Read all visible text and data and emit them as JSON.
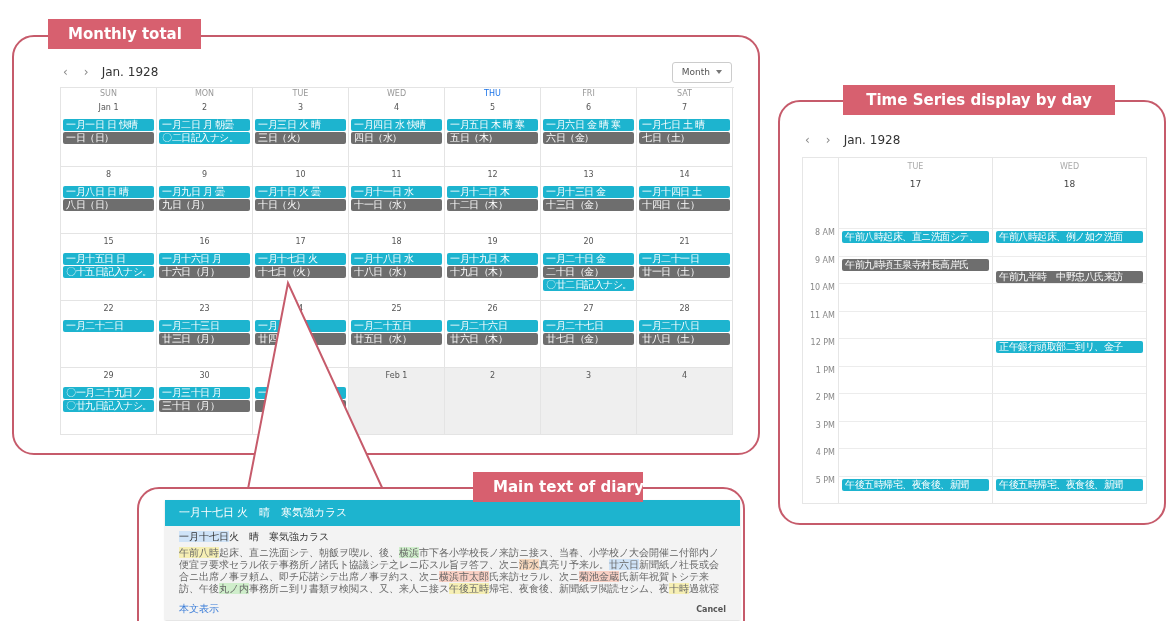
{
  "monthly": {
    "label": "Monthly total",
    "calendar": {
      "prev": "‹",
      "next": "›",
      "title": "Jan. 1928",
      "view": "Month",
      "weekdays": [
        {
          "label": "SUN",
          "today": false
        },
        {
          "label": "MON",
          "today": false
        },
        {
          "label": "TUE",
          "today": false
        },
        {
          "label": "WED",
          "today": false
        },
        {
          "label": "THU",
          "today": true
        },
        {
          "label": "FRI",
          "today": false
        },
        {
          "label": "SAT",
          "today": false
        }
      ],
      "weeks": [
        [
          {
            "date": "Jan 1",
            "outside": false,
            "events": [
              {
                "text": "一月一日 日 快晴",
                "kind": "entry"
              },
              {
                "text": "一日（日）",
                "kind": "date"
              }
            ]
          },
          {
            "date": "2",
            "outside": false,
            "events": [
              {
                "text": "一月二日 月 朝曇",
                "kind": "entry"
              },
              {
                "text": "〇二日記入ナシ。",
                "kind": "entry"
              }
            ]
          },
          {
            "date": "3",
            "outside": false,
            "events": [
              {
                "text": "一月三日 火 晴",
                "kind": "entry"
              },
              {
                "text": "三日（火）",
                "kind": "date"
              }
            ]
          },
          {
            "date": "4",
            "outside": false,
            "events": [
              {
                "text": "一月四日 水 快晴",
                "kind": "entry"
              },
              {
                "text": "四日（水）",
                "kind": "date"
              }
            ]
          },
          {
            "date": "5",
            "outside": false,
            "events": [
              {
                "text": "一月五日 木 晴 寒",
                "kind": "entry"
              },
              {
                "text": "五日（木）",
                "kind": "date"
              }
            ]
          },
          {
            "date": "6",
            "outside": false,
            "events": [
              {
                "text": "一月六日 金 晴 寒",
                "kind": "entry"
              },
              {
                "text": "六日（金）",
                "kind": "date"
              }
            ]
          },
          {
            "date": "7",
            "outside": false,
            "events": [
              {
                "text": "一月七日 土 晴",
                "kind": "entry"
              },
              {
                "text": "七日（土）",
                "kind": "date"
              }
            ]
          }
        ],
        [
          {
            "date": "8",
            "outside": false,
            "events": [
              {
                "text": "一月八日 日 晴",
                "kind": "entry"
              },
              {
                "text": "八日（日）",
                "kind": "date"
              }
            ]
          },
          {
            "date": "9",
            "outside": false,
            "events": [
              {
                "text": "一月九日 月 曇",
                "kind": "entry"
              },
              {
                "text": "九日（月）",
                "kind": "date"
              }
            ]
          },
          {
            "date": "10",
            "outside": false,
            "events": [
              {
                "text": "一月十日 火 曇",
                "kind": "entry"
              },
              {
                "text": "十日（火）",
                "kind": "date"
              }
            ]
          },
          {
            "date": "11",
            "outside": false,
            "events": [
              {
                "text": "一月十一日 水",
                "kind": "entry"
              },
              {
                "text": "十一日（水）",
                "kind": "date"
              }
            ]
          },
          {
            "date": "12",
            "outside": false,
            "events": [
              {
                "text": "一月十二日 木",
                "kind": "entry"
              },
              {
                "text": "十二日（木）",
                "kind": "date"
              }
            ]
          },
          {
            "date": "13",
            "outside": false,
            "events": [
              {
                "text": "一月十三日 金",
                "kind": "entry"
              },
              {
                "text": "十三日（金）",
                "kind": "date"
              }
            ]
          },
          {
            "date": "14",
            "outside": false,
            "events": [
              {
                "text": "一月十四日 土",
                "kind": "entry"
              },
              {
                "text": "十四日（土）",
                "kind": "date"
              }
            ]
          }
        ],
        [
          {
            "date": "15",
            "outside": false,
            "events": [
              {
                "text": "一月十五日 日",
                "kind": "entry"
              },
              {
                "text": "〇十五日記入ナシ。",
                "kind": "entry"
              }
            ]
          },
          {
            "date": "16",
            "outside": false,
            "events": [
              {
                "text": "一月十六日 月",
                "kind": "entry"
              },
              {
                "text": "十六日（月）",
                "kind": "date"
              }
            ]
          },
          {
            "date": "17",
            "outside": false,
            "events": [
              {
                "text": "一月十七日 火",
                "kind": "entry"
              },
              {
                "text": "十七日（火）",
                "kind": "date"
              }
            ]
          },
          {
            "date": "18",
            "outside": false,
            "events": [
              {
                "text": "一月十八日 水",
                "kind": "entry"
              },
              {
                "text": "十八日（水）",
                "kind": "date"
              }
            ]
          },
          {
            "date": "19",
            "outside": false,
            "events": [
              {
                "text": "一月十九日 木",
                "kind": "entry"
              },
              {
                "text": "十九日（木）",
                "kind": "date"
              }
            ]
          },
          {
            "date": "20",
            "outside": false,
            "events": [
              {
                "text": "一月二十日 金",
                "kind": "entry"
              },
              {
                "text": "二十日（金）",
                "kind": "date"
              },
              {
                "text": "〇廿二日記入ナシ。",
                "kind": "entry"
              }
            ]
          },
          {
            "date": "21",
            "outside": false,
            "events": [
              {
                "text": "一月二十一日",
                "kind": "entry"
              },
              {
                "text": "廿一日（土）",
                "kind": "date"
              }
            ]
          }
        ],
        [
          {
            "date": "22",
            "outside": false,
            "events": [
              {
                "text": "一月二十二日",
                "kind": "entry"
              }
            ]
          },
          {
            "date": "23",
            "outside": false,
            "events": [
              {
                "text": "一月二十三日",
                "kind": "entry"
              },
              {
                "text": "廿三日（月）",
                "kind": "date"
              }
            ]
          },
          {
            "date": "4",
            "outside": false,
            "events": [
              {
                "text": "一月",
                "kind": "entry"
              },
              {
                "text": "廿四",
                "kind": "date"
              }
            ]
          },
          {
            "date": "25",
            "outside": false,
            "events": [
              {
                "text": "一月二十五日",
                "kind": "entry"
              },
              {
                "text": "廿五日（水）",
                "kind": "date"
              }
            ]
          },
          {
            "date": "26",
            "outside": false,
            "events": [
              {
                "text": "一月二十六日",
                "kind": "entry"
              },
              {
                "text": "廿六日（木）",
                "kind": "date"
              }
            ]
          },
          {
            "date": "27",
            "outside": false,
            "events": [
              {
                "text": "一月二十七日",
                "kind": "entry"
              },
              {
                "text": "廿七日（金）",
                "kind": "date"
              }
            ]
          },
          {
            "date": "28",
            "outside": false,
            "events": [
              {
                "text": "一月二十八日",
                "kind": "entry"
              },
              {
                "text": "廿八日（土）",
                "kind": "date"
              }
            ]
          }
        ],
        [
          {
            "date": "29",
            "outside": false,
            "events": [
              {
                "text": "〇一月二十九日ノ",
                "kind": "entry"
              },
              {
                "text": "〇廿九日記入ナシ。",
                "kind": "entry"
              }
            ]
          },
          {
            "date": "30",
            "outside": false,
            "events": [
              {
                "text": "一月三十日 月",
                "kind": "entry"
              },
              {
                "text": "三十日（月）",
                "kind": "date"
              }
            ]
          },
          {
            "outside": false,
            "events": [
              {
                "text": "一",
                "kind": "entry"
              },
              {
                "kind": "date"
              }
            ]
          },
          {
            "date": "Feb 1",
            "outside": true
          },
          {
            "date": "2",
            "outside": true
          },
          {
            "date": "3",
            "outside": true
          },
          {
            "date": "4",
            "outside": true
          }
        ]
      ]
    }
  },
  "day_view": {
    "label": "Time Series display by day",
    "prev": "‹",
    "next": "›",
    "title": "Jan. 1928",
    "columns": [
      {
        "weekday": "TUE",
        "date": "17"
      },
      {
        "weekday": "WED",
        "date": "18"
      }
    ],
    "hours": [
      {
        "label": "8 AM",
        "cells": [
          {
            "events": [
              {
                "text": "午前八時起床、直ニ洗面シテ、",
                "kind": "entry"
              }
            ]
          },
          {
            "events": [
              {
                "text": "午前八時起床、例ノ如ク洗面",
                "kind": "entry"
              }
            ]
          }
        ]
      },
      {
        "label": "9 AM",
        "cells": [
          {
            "events": [
              {
                "text": "午前九時頃玉泉寺村長高岸氏",
                "kind": "date"
              }
            ]
          },
          {
            "events": [
              {
                "text": "午前九半時　中野忠八氏来訪",
                "kind": "date",
                "half_hour": true
              }
            ]
          }
        ]
      },
      {
        "label": "10 AM",
        "cells": [
          {},
          {}
        ]
      },
      {
        "label": "11 AM",
        "cells": [
          {},
          {}
        ]
      },
      {
        "label": "12 PM",
        "cells": [
          {},
          {
            "events": [
              {
                "text": "正午銀行頭取部二到リ、金子",
                "kind": "entry"
              }
            ]
          }
        ]
      },
      {
        "label": "1 PM",
        "cells": [
          {},
          {}
        ]
      },
      {
        "label": "2 PM",
        "cells": [
          {},
          {}
        ]
      },
      {
        "label": "3 PM",
        "cells": [
          {},
          {}
        ]
      },
      {
        "label": "4 PM",
        "cells": [
          {},
          {}
        ]
      },
      {
        "label": "5 PM",
        "cells": [
          {
            "events": [
              {
                "text": "午後五時帰宅、夜食後、新聞",
                "kind": "entry"
              }
            ]
          },
          {
            "events": [
              {
                "text": "午後五時帰宅、夜食後、新聞",
                "kind": "entry"
              }
            ]
          }
        ]
      }
    ]
  },
  "diary": {
    "label": "Main text of diary",
    "title": "一月十七日 火　晴　寒気強カラス",
    "subtitle": [
      {
        "text": "一月十七日",
        "color": "#cfe3f7"
      },
      {
        "text": "火　晴　寒気強カラス"
      }
    ],
    "body": [
      {
        "text": "午前八時",
        "color": "#f6efb4"
      },
      {
        "text": "起床、直ニ洗面シテ、朝飯ヲ喫ル、後、"
      },
      {
        "text": "横浜",
        "color": "#cfeecb"
      },
      {
        "text": "市下各小学校長ノ来訪ニ接ス、当春、小学校ノ大会開催ニ付部内ノ便宜ヲ要求セラル依テ事務所ノ諸氏ト協議シテ之レニ応スル旨ヲ答フ、次ニ"
      },
      {
        "text": "清水",
        "color": "#f9d9bd"
      },
      {
        "text": "真亮リ予来ル。"
      },
      {
        "text": "廿六日",
        "color": "#cfe3f7"
      },
      {
        "text": "新聞紙ノ社長或会合ニ出席ノ事ヲ頼ム、即チ応諾シテ出席ノ事ヲ約ス、次ニ"
      },
      {
        "text": "横浜市太郎",
        "color": "#f9d0c4"
      },
      {
        "text": "氏来訪セラル、次ニ"
      },
      {
        "text": "菊池金蔵",
        "color": "#f9d0c4"
      },
      {
        "text": "氏新年祝賀トシテ来訪、午後"
      },
      {
        "text": "丸ノ内",
        "color": "#cfeecb"
      },
      {
        "text": "事務所ニ到リ書類ヲ検閲ス、又、来人ニ接ス"
      },
      {
        "text": "午後五時",
        "color": "#f6efb4"
      },
      {
        "text": "帰宅、夜食後、新聞紙ヲ閲読セシム、夜"
      },
      {
        "text": "十時",
        "color": "#f6efb4"
      },
      {
        "text": "過就寝"
      }
    ],
    "link": "本文表示",
    "cancel": "Cancel"
  }
}
